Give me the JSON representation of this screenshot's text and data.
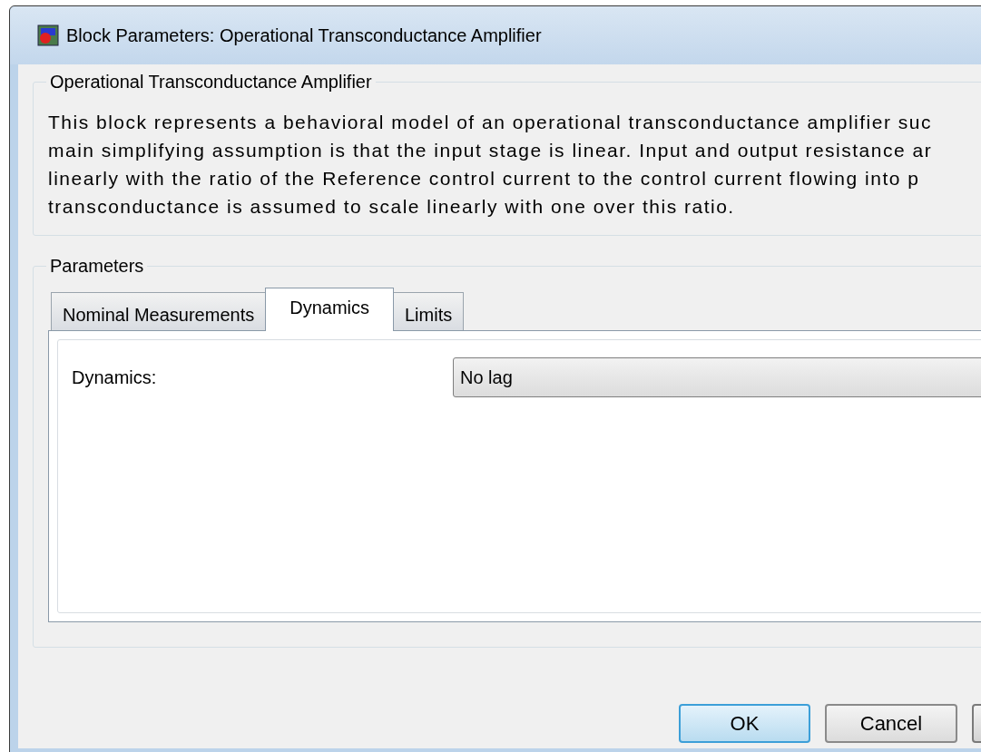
{
  "window": {
    "title": "Block Parameters: Operational Transconductance Amplifier"
  },
  "description_group": {
    "title": "Operational Transconductance Amplifier",
    "lines": [
      "This block represents a behavioral model of an operational transconductance amplifier suc",
      "main simplifying assumption is that the input stage is linear. Input and output resistance ar",
      "linearly with the ratio of the Reference control current to the control current flowing into p",
      "transconductance is assumed to scale linearly with one over this ratio."
    ]
  },
  "parameters_group": {
    "title": "Parameters",
    "tabs": [
      {
        "label": "Nominal Measurements",
        "selected": false
      },
      {
        "label": "Dynamics",
        "selected": true
      },
      {
        "label": "Limits",
        "selected": false
      }
    ],
    "fields": [
      {
        "label": "Dynamics:",
        "value": "No lag"
      }
    ]
  },
  "buttons": [
    {
      "label": "OK",
      "default": true
    },
    {
      "label": "Cancel",
      "default": false
    },
    {
      "kind": "partial"
    }
  ]
}
